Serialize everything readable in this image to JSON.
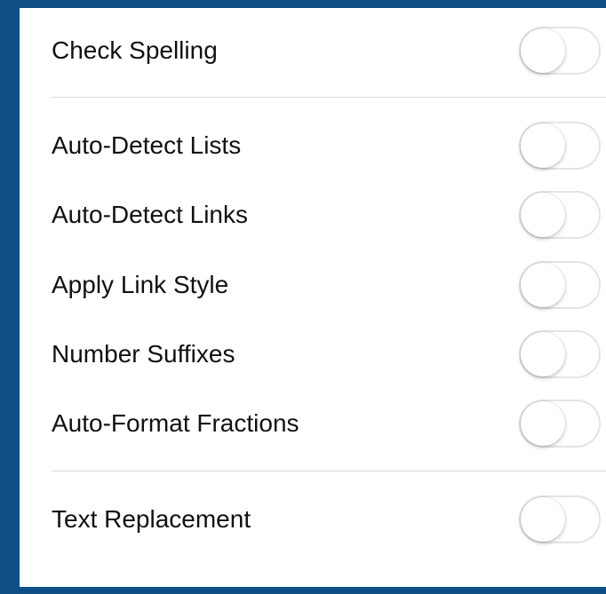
{
  "settings": {
    "check_spelling": {
      "label": "Check Spelling",
      "on": false
    },
    "auto_detect_lists": {
      "label": "Auto-Detect Lists",
      "on": false
    },
    "auto_detect_links": {
      "label": "Auto-Detect Links",
      "on": false
    },
    "apply_link_style": {
      "label": "Apply Link Style",
      "on": false
    },
    "number_suffixes": {
      "label": "Number Suffixes",
      "on": false
    },
    "auto_format_fractions": {
      "label": "Auto-Format Fractions",
      "on": false
    },
    "text_replacement": {
      "label": "Text Replacement",
      "on": false
    }
  },
  "colors": {
    "frame_border": "#0d4f86",
    "toggle_off_track": "#ffffff",
    "divider": "#dadada"
  }
}
